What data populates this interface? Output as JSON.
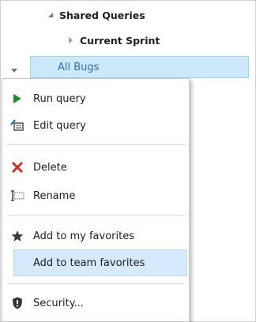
{
  "tree": {
    "shared_queries": "Shared Queries",
    "current_sprint": "Current Sprint",
    "all_bugs": "All Bugs"
  },
  "menu": {
    "run_query": "Run query",
    "edit_query": "Edit query",
    "delete": "Delete",
    "rename": "Rename",
    "add_my_favorites": "Add to my favorites",
    "add_team_favorites": "Add to team favorites",
    "security": "Security..."
  },
  "icons": {
    "run": "play-icon",
    "edit": "edit-query-icon",
    "delete": "delete-x-icon",
    "rename": "rename-icon",
    "favorite": "star-icon",
    "security": "shield-icon"
  },
  "colors": {
    "selection_bg": "#cce8fb",
    "link_blue": "#2b6fb6",
    "run_green": "#1e8a2e",
    "delete_red": "#d62b1f"
  }
}
